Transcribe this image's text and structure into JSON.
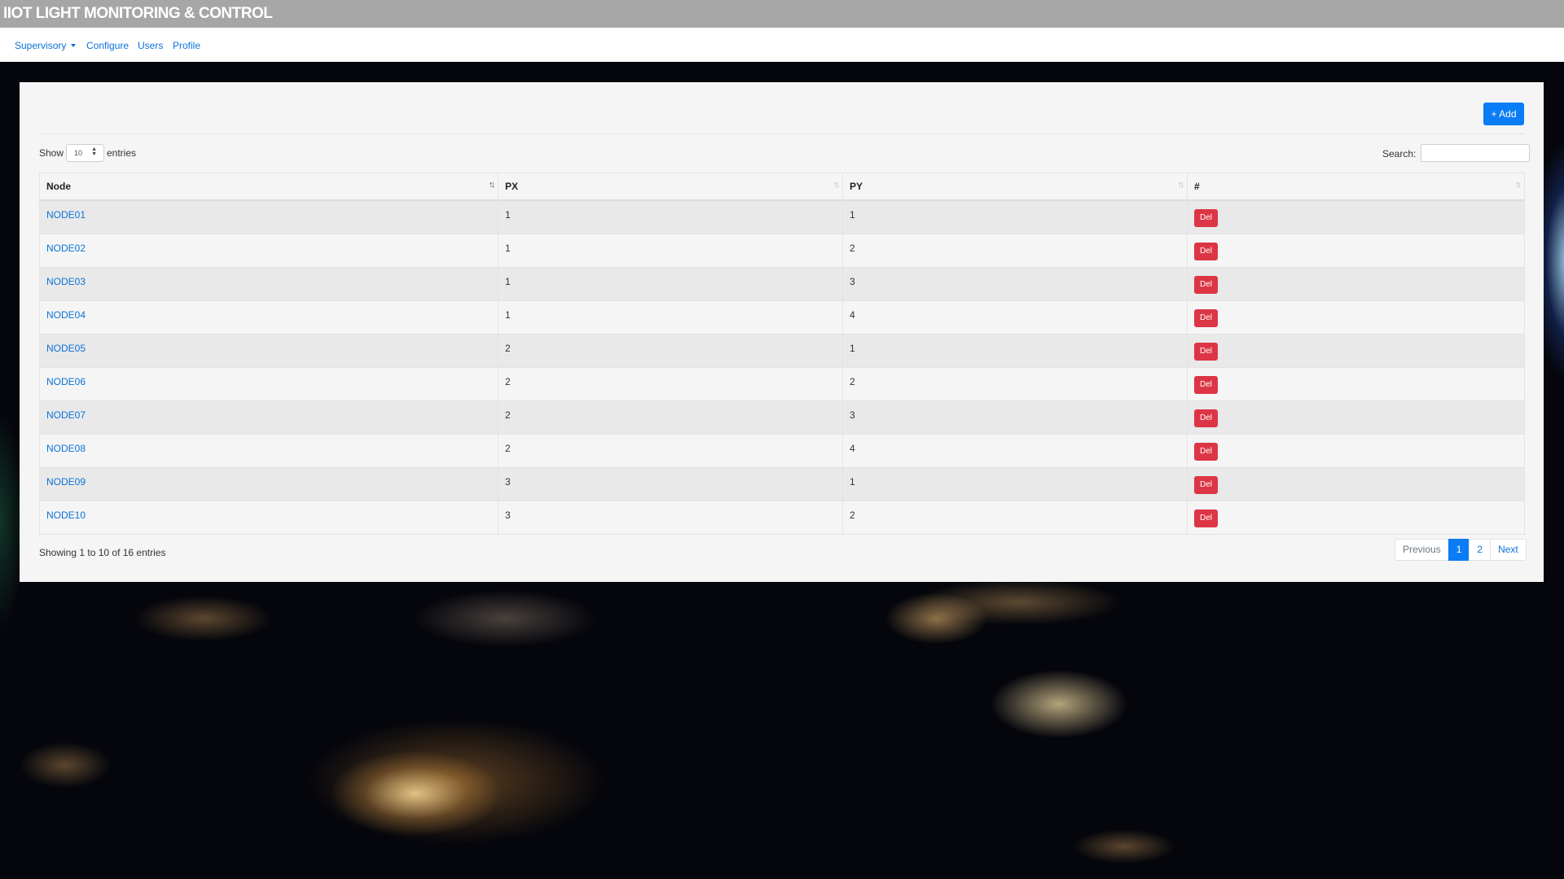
{
  "app": {
    "title": "IIOT LIGHT MONITORING & CONTROL"
  },
  "nav": {
    "supervisory": "Supervisory",
    "configure": "Configure",
    "users": "Users",
    "profile": "Profile"
  },
  "toolbar": {
    "add_label": "+ Add"
  },
  "table_controls": {
    "show_label": "Show",
    "page_length": "10",
    "entries_label": "entries",
    "search_label": "Search:",
    "search_value": ""
  },
  "table": {
    "columns": [
      "Node",
      "PX",
      "PY",
      "#"
    ],
    "rows": [
      {
        "node": "NODE01",
        "px": "1",
        "py": "1",
        "action": "Del"
      },
      {
        "node": "NODE02",
        "px": "1",
        "py": "2",
        "action": "Del"
      },
      {
        "node": "NODE03",
        "px": "1",
        "py": "3",
        "action": "Del"
      },
      {
        "node": "NODE04",
        "px": "1",
        "py": "4",
        "action": "Del"
      },
      {
        "node": "NODE05",
        "px": "2",
        "py": "1",
        "action": "Del"
      },
      {
        "node": "NODE06",
        "px": "2",
        "py": "2",
        "action": "Del"
      },
      {
        "node": "NODE07",
        "px": "2",
        "py": "3",
        "action": "Del"
      },
      {
        "node": "NODE08",
        "px": "2",
        "py": "4",
        "action": "Del"
      },
      {
        "node": "NODE09",
        "px": "3",
        "py": "1",
        "action": "Del"
      },
      {
        "node": "NODE10",
        "px": "3",
        "py": "2",
        "action": "Del"
      }
    ]
  },
  "footer": {
    "info": "Showing 1 to 10 of 16 entries"
  },
  "pagination": {
    "previous": "Previous",
    "pages": [
      "1",
      "2"
    ],
    "current_page": "1",
    "next": "Next"
  },
  "colors": {
    "title_bar": "#a6a6a6",
    "link": "#0b72d9",
    "primary": "#0a7cf5",
    "danger": "#dc3545"
  }
}
